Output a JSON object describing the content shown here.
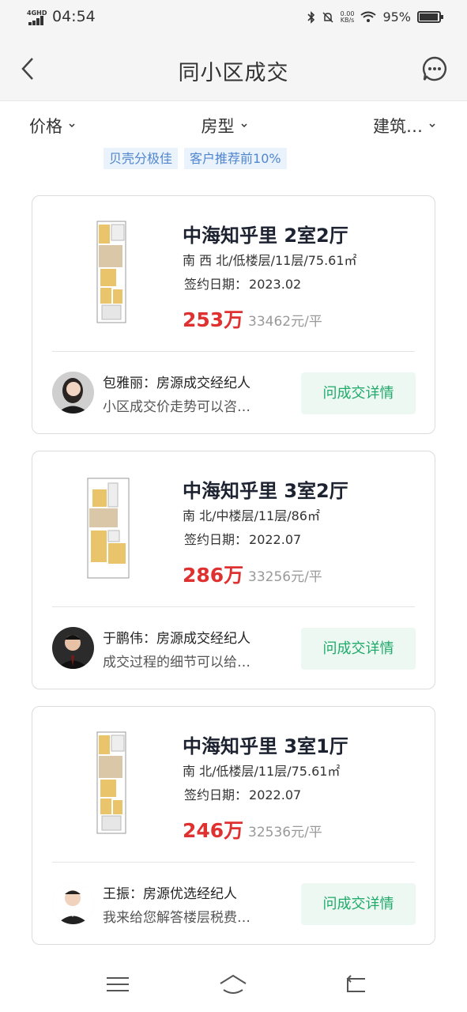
{
  "status": {
    "network": "4GHD",
    "time": "04:54",
    "speed_value": "0.00",
    "speed_unit": "KB/s",
    "battery": "95%",
    "battery_level": 0.95
  },
  "header": {
    "title": "同小区成交"
  },
  "filters": [
    {
      "label": "价格"
    },
    {
      "label": "房型"
    },
    {
      "label": "建筑…"
    }
  ],
  "tags": [
    "贝壳分极佳",
    "客户推荐前10%"
  ],
  "listings": [
    {
      "title": "中海知乎里 2室2厅",
      "meta": "南 西 北/低楼层/11层/75.61㎡",
      "date_label": "签约日期：",
      "date": "2023.02",
      "price": "253万",
      "unit_price": "33462元/平",
      "agent": "包雅丽：房源成交经纪人",
      "pitch": "小区成交价走势可以咨…",
      "button": "问成交详情"
    },
    {
      "title": "中海知乎里 3室2厅",
      "meta": "南 北/中楼层/11层/86㎡",
      "date_label": "签约日期：",
      "date": "2022.07",
      "price": "286万",
      "unit_price": "33256元/平",
      "agent": "于鹏伟：房源成交经纪人",
      "pitch": "成交过程的细节可以给…",
      "button": "问成交详情"
    },
    {
      "title": "中海知乎里 3室1厅",
      "meta": "南 北/低楼层/11层/75.61㎡",
      "date_label": "签约日期：",
      "date": "2022.07",
      "price": "246万",
      "unit_price": "32536元/平",
      "agent": "王振：房源优选经纪人",
      "pitch": "我来给您解答楼层税费…",
      "button": "问成交详情"
    }
  ],
  "colors": {
    "price": "#e03131",
    "accent_green": "#1faa6a",
    "tag_blue": "#4f86cf"
  },
  "icons": [
    "back-icon",
    "message-icon",
    "chevron-down-icon",
    "menu-icon",
    "home-icon",
    "return-icon"
  ]
}
